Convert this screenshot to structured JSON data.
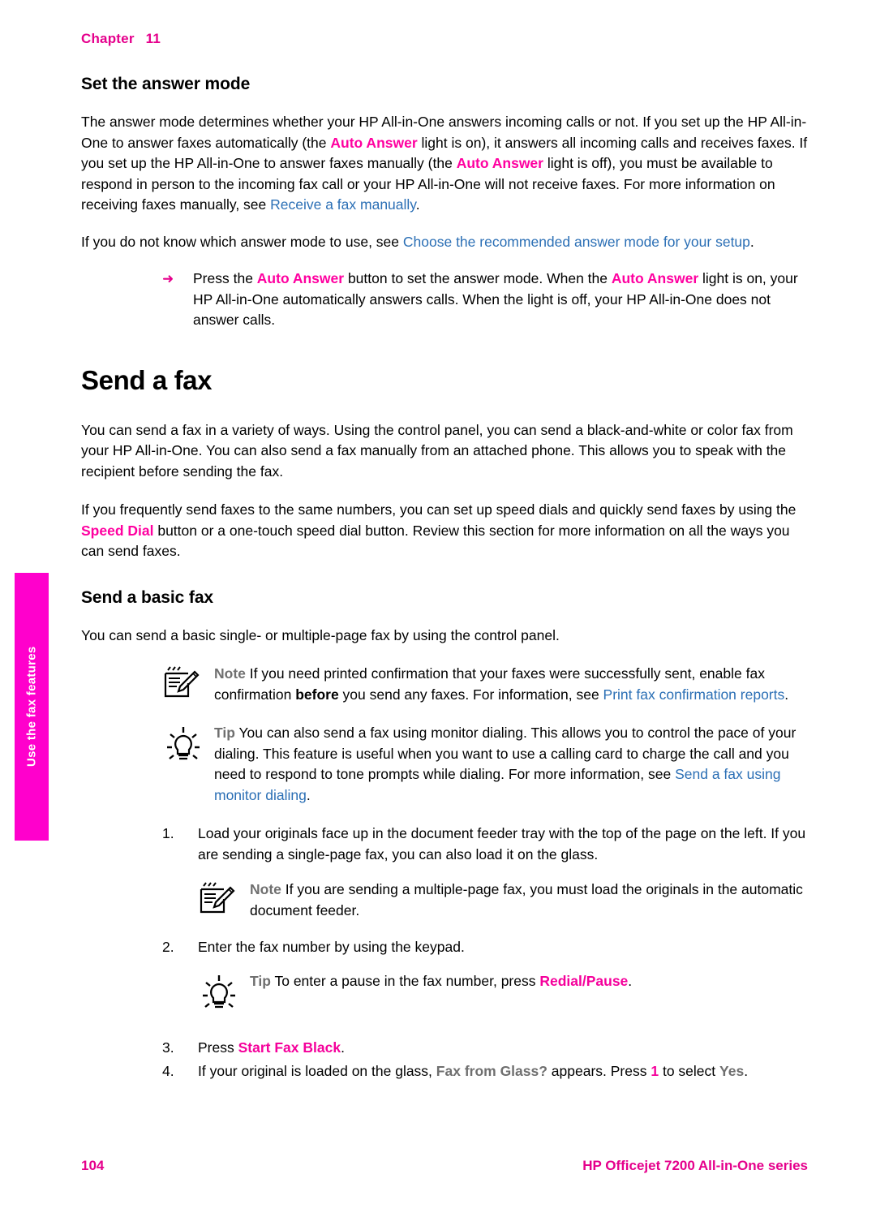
{
  "header": {
    "chapter_label": "Chapter",
    "chapter_number": "11"
  },
  "side_tab": {
    "label": "Use the fax features",
    "color": "#ff00cc"
  },
  "sections": {
    "answer_mode": {
      "heading": "Set the answer mode",
      "p1_a": "The answer mode determines whether your HP All-in-One answers incoming calls or not. If you set up the HP All-in-One to answer faxes automatically (the ",
      "p1_b": "Auto Answer",
      "p1_c": " light is on), it answers all incoming calls and receives faxes. If you set up the HP All-in-One to answer faxes manually (the ",
      "p1_d": "Auto Answer",
      "p1_e": " light is off), you must be available to respond in person to the incoming fax call or your HP All-in-One will not receive faxes. For more information on receiving faxes manually, see ",
      "p1_link": "Receive a fax manually",
      "p1_f": ".",
      "p2_a": "If you do not know which answer mode to use, see ",
      "p2_link": "Choose the recommended answer mode for your setup",
      "p2_b": ".",
      "arrow_glyph": "➜",
      "step_a": "Press the ",
      "step_b": "Auto Answer",
      "step_c": " button to set the answer mode. When the ",
      "step_d": "Auto Answer",
      "step_e": " light is on, your HP All-in-One automatically answers calls. When the light is off, your HP All-in-One does not answer calls."
    },
    "send_a_fax": {
      "heading": "Send a fax",
      "p1": "You can send a fax in a variety of ways. Using the control panel, you can send a black-and-white or color fax from your HP All-in-One. You can also send a fax manually from an attached phone. This allows you to speak with the recipient before sending the fax.",
      "p2_a": "If you frequently send faxes to the same numbers, you can set up speed dials and quickly send faxes by using the ",
      "p2_b": "Speed Dial",
      "p2_c": " button or a one-touch speed dial button. Review this section for more information on all the ways you can send faxes."
    },
    "send_basic_fax": {
      "heading": "Send a basic fax",
      "p1": "You can send a basic single- or multiple-page fax by using the control panel.",
      "note1_label": "Note",
      "note1_a": "   If you need printed confirmation that your faxes were successfully sent, enable fax confirmation ",
      "note1_bold": "before",
      "note1_b": " you send any faxes. For information, see ",
      "note1_link": "Print fax confirmation reports",
      "note1_c": ".",
      "tip1_label": "Tip",
      "tip1_a": "   You can also send a fax using monitor dialing. This allows you to control the pace of your dialing. This feature is useful when you want to use a calling card to charge the call and you need to respond to tone prompts while dialing. For more information, see ",
      "tip1_link": "Send a fax using monitor dialing",
      "tip1_b": ".",
      "steps": [
        {
          "num": "1.",
          "text": "Load your originals face up in the document feeder tray with the top of the page on the left. If you are sending a single-page fax, you can also load it on the glass."
        },
        {
          "num": "2.",
          "text": "Enter the fax number by using the keypad."
        }
      ],
      "note2_label": "Note",
      "note2_text": "   If you are sending a multiple-page fax, you must load the originals in the automatic document feeder.",
      "tip2_label": "Tip",
      "tip2_a": "   To enter a pause in the fax number, press ",
      "tip2_b": "Redial/Pause",
      "tip2_c": ".",
      "step3_num": "3.",
      "step3_a": "Press ",
      "step3_b": "Start Fax Black",
      "step3_c": ".",
      "step4_num": "4.",
      "step4_a": "If your original is loaded on the glass, ",
      "step4_b": "Fax from Glass?",
      "step4_c": " appears. Press ",
      "step4_d": "1",
      "step4_e": " to select ",
      "step4_f": "Yes",
      "step4_g": "."
    }
  },
  "footer": {
    "page_number": "104",
    "product": "HP Officejet 7200 All-in-One series"
  }
}
